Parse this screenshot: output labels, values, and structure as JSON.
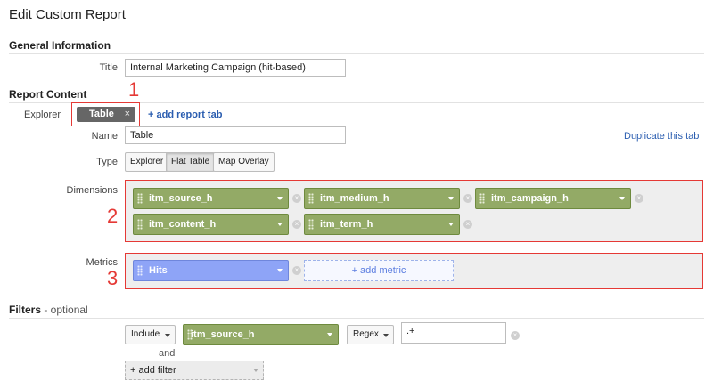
{
  "page_title": "Edit Custom Report",
  "general": {
    "heading": "General Information",
    "title_label": "Title",
    "title_value": "Internal Marketing Campaign (hit-based)"
  },
  "content": {
    "heading": "Report Content",
    "explorer_label": "Explorer",
    "tab_chip": "Table",
    "tab_close": "×",
    "add_tab": "+ add report tab",
    "name_label": "Name",
    "name_value": "Table",
    "duplicate": "Duplicate this tab",
    "type_label": "Type",
    "types": [
      "Explorer",
      "Flat Table",
      "Map Overlay"
    ],
    "type_selected": "Flat Table",
    "dimensions_label": "Dimensions",
    "dimensions": [
      "itm_source_h",
      "itm_medium_h",
      "itm_campaign_h",
      "itm_content_h",
      "itm_term_h"
    ],
    "metrics_label": "Metrics",
    "metrics": [
      "Hits"
    ],
    "add_metric": "+ add metric"
  },
  "filters": {
    "heading": "Filters",
    "heading_suffix": " - optional",
    "include": "Include",
    "dimension": "itm_source_h",
    "match": "Regex",
    "value": ".+",
    "and": "and",
    "add_filter": "+ add filter"
  },
  "annotations": [
    "1",
    "2",
    "3"
  ],
  "colors": {
    "dimension_pill": "#93aa66",
    "metric_pill": "#8ea4f7",
    "highlight": "#e53935",
    "link": "#2a5db0"
  }
}
